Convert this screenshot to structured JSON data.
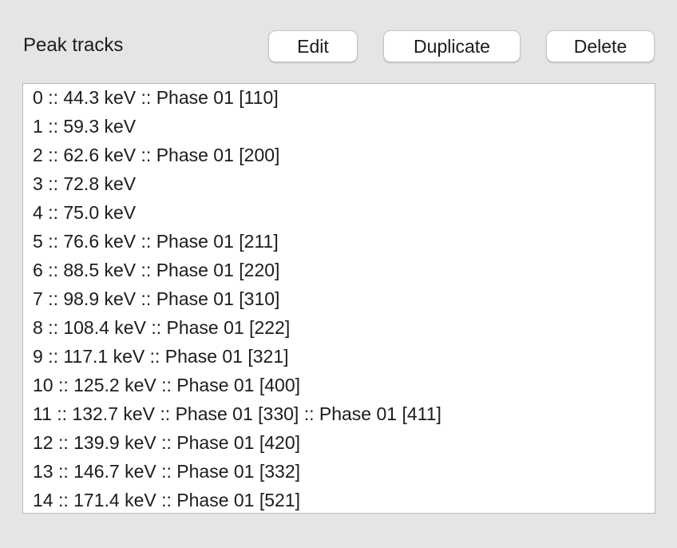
{
  "header": {
    "label": "Peak tracks"
  },
  "toolbar": {
    "edit_label": "Edit",
    "duplicate_label": "Duplicate",
    "delete_label": "Delete"
  },
  "peak_list": {
    "items": [
      "0 :: 44.3 keV :: Phase 01 [110]",
      "1 :: 59.3 keV",
      "2 :: 62.6 keV :: Phase 01 [200]",
      "3 :: 72.8 keV",
      "4 :: 75.0 keV",
      "5 :: 76.6 keV :: Phase 01 [211]",
      "6 :: 88.5 keV :: Phase 01 [220]",
      "7 :: 98.9 keV :: Phase 01 [310]",
      "8 :: 108.4 keV :: Phase 01 [222]",
      "9 :: 117.1 keV :: Phase 01 [321]",
      "10 :: 125.2 keV :: Phase 01 [400]",
      "11 :: 132.7 keV :: Phase 01 [330] :: Phase 01 [411]",
      "12 :: 139.9 keV :: Phase 01 [420]",
      "13 :: 146.7 keV :: Phase 01 [332]",
      "14 :: 171.4 keV :: Phase 01 [521]"
    ]
  }
}
